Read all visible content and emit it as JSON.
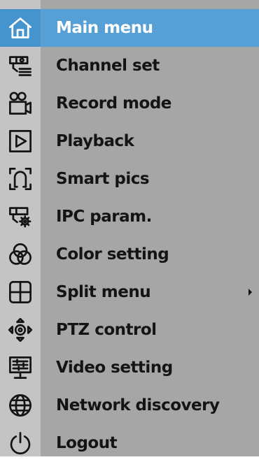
{
  "menu": {
    "items": [
      {
        "label": "Main menu",
        "icon": "home-icon",
        "selected": true
      },
      {
        "label": "Channel set",
        "icon": "camera-list-icon"
      },
      {
        "label": "Record mode",
        "icon": "video-camera-icon"
      },
      {
        "label": "Playback",
        "icon": "play-icon"
      },
      {
        "label": "Smart pics",
        "icon": "face-frame-icon"
      },
      {
        "label": "IPC param.",
        "icon": "camera-gear-icon"
      },
      {
        "label": "Color setting",
        "icon": "color-circles-icon"
      },
      {
        "label": "Split menu",
        "icon": "split-grid-icon",
        "has_submenu": true
      },
      {
        "label": "PTZ control",
        "icon": "ptz-arrows-icon"
      },
      {
        "label": "Video setting",
        "icon": "monitor-sliders-icon"
      },
      {
        "label": "Network discovery",
        "icon": "globe-icon"
      },
      {
        "label": "Logout",
        "icon": "power-icon"
      }
    ]
  },
  "colors": {
    "selected_bg": "#56a0d6",
    "menu_bg": "#a6a6a6",
    "icon_column_bg": "#c4c4c4"
  }
}
